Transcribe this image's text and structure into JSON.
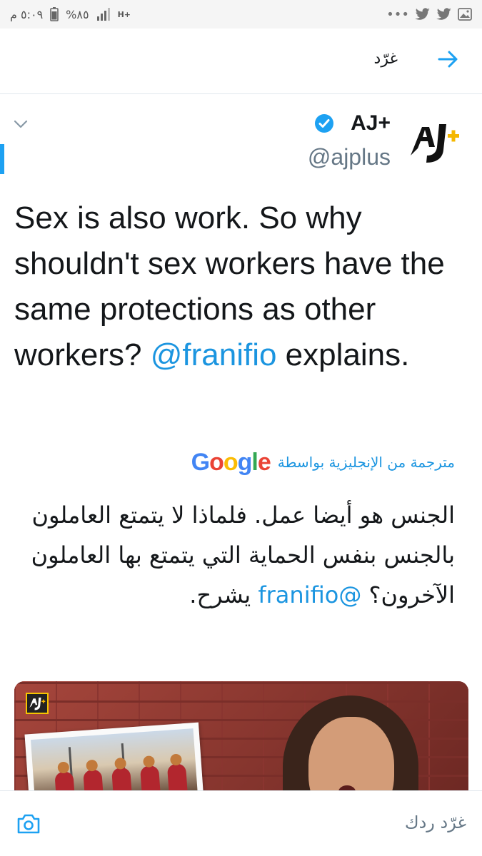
{
  "status_bar": {
    "time": "٥:٠٩ م",
    "battery": "%٨٥",
    "network": "H+",
    "left_icons": [
      "signal-icon",
      "battery-icon"
    ],
    "right_icons": [
      "image-notification-icon",
      "twitter-bird-icon",
      "twitter-bird-icon",
      "more-dots-icon"
    ]
  },
  "header": {
    "title": "غرّد"
  },
  "tweet": {
    "display_name": "AJ+",
    "handle": "@ajplus",
    "avatar_text": "AJ+",
    "text_parts": {
      "before_mention": "Sex is also work. So why shouldn't sex workers have the same protections as other workers? ",
      "mention": "@franifio",
      "after_mention": " explains."
    },
    "translation_label": "مترجمة من الإنجليزية بواسطة",
    "translation_provider": "Google",
    "translation_parts": {
      "before_mention": "الجنس هو أيضا عمل. فلماذا لا يتمتع العاملون بالجنس بنفس الحماية التي يتمتع بها العاملون الآخرون؟ ",
      "mention": "@franifio",
      "after_mention": " يشرح."
    }
  },
  "reply_bar": {
    "placeholder": "غرّد ردك"
  },
  "colors": {
    "accent": "#1da1f2",
    "link": "#1b95e0",
    "secondary_text": "#657786",
    "border": "#e1e8ed"
  }
}
